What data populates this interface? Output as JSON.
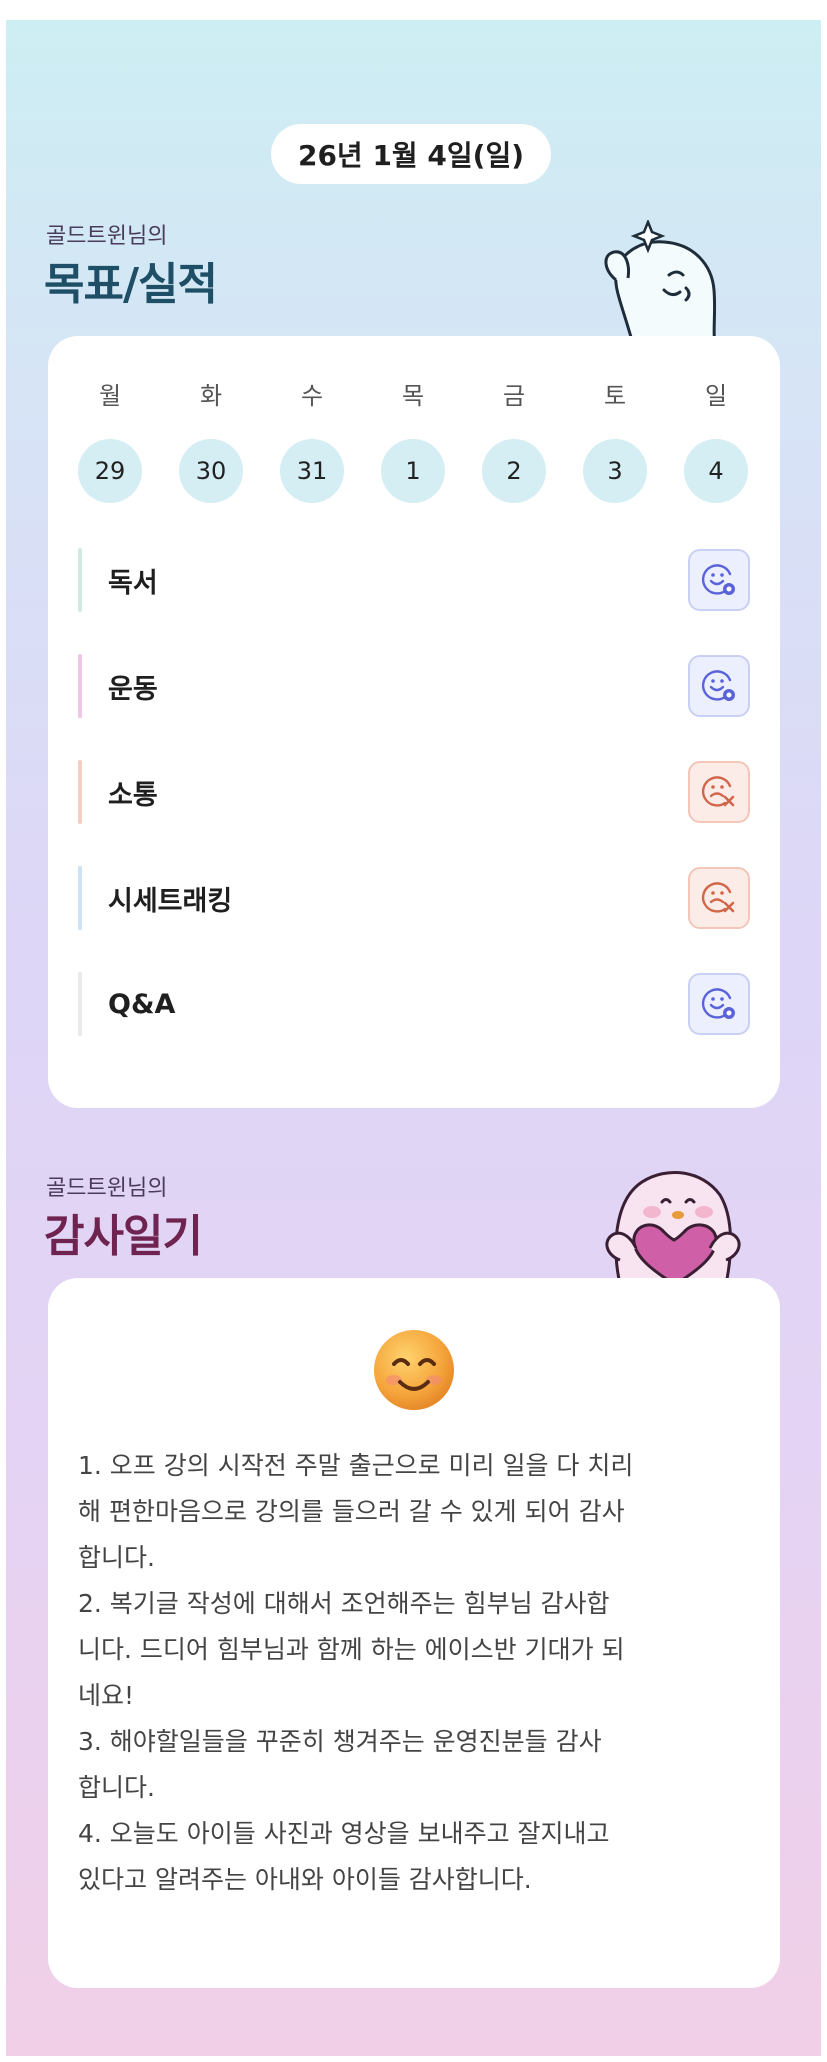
{
  "date_label": "26년 1월 4일(일)",
  "goals_section": {
    "owner": "골드트윈님의",
    "title": "목표/실적"
  },
  "week": {
    "days": [
      "월",
      "화",
      "수",
      "목",
      "금",
      "토",
      "일"
    ],
    "dates": [
      "29",
      "30",
      "31",
      "1",
      "2",
      "3",
      "4"
    ]
  },
  "goals": [
    {
      "label": "독서",
      "status": "done",
      "bar_color": "#cfe9e3"
    },
    {
      "label": "운동",
      "status": "done",
      "bar_color": "#ecc8e6"
    },
    {
      "label": "소통",
      "status": "missed",
      "bar_color": "#f5cfc1"
    },
    {
      "label": "시세트래킹",
      "status": "missed",
      "bar_color": "#cde3f3"
    },
    {
      "label": "Q&A",
      "status": "done",
      "bar_color": "#e9e9e9"
    }
  ],
  "gratitude_section": {
    "owner": "골드트윈님의",
    "title": "감사일기"
  },
  "diary_lines": [
    "1. 오프 강의 시작전 주말 출근으로 미리 일을 다 치리",
    "해 편한마음으로 강의를 들으러 갈 수 있게 되어 감사",
    "합니다.",
    "2. 복기글 작성에 대해서 조언해주는 힘부님 감사합",
    "니다. 드디어 힘부님과 함께 하는 에이스반 기대가 되",
    "네요!",
    "3. 해야할일들을 꾸준히 챙겨주는 운영진분들 감사",
    "합니다.",
    "4. 오늘도 아이들 사진과 영상을 보내주고 잘지내고",
    "있다고 알려주는 아내와 아이들 감사합니다."
  ],
  "colors": {
    "status_done": "#5a63d8",
    "status_missed": "#d2664a",
    "day_circle": "#d4eef4"
  }
}
